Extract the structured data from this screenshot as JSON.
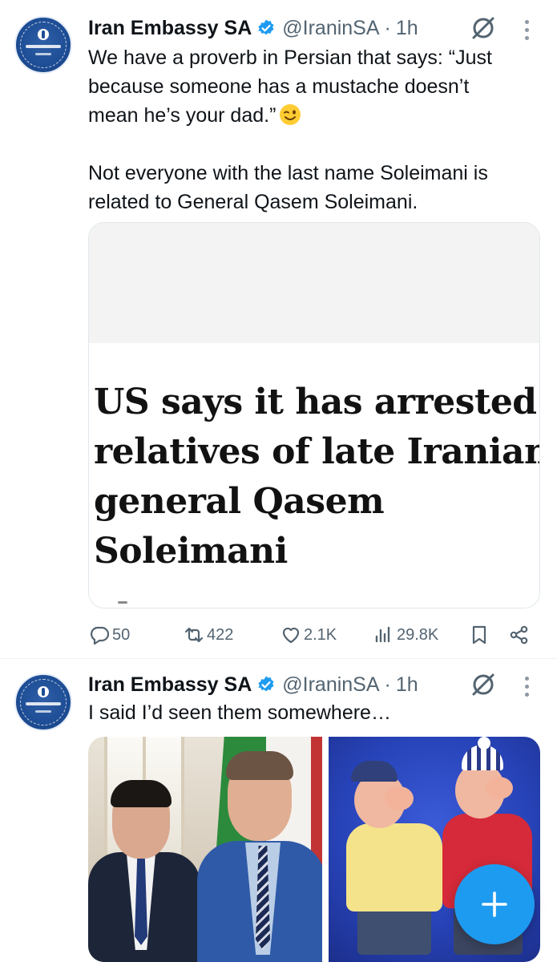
{
  "colors": {
    "accent": "#1d9bf0",
    "text": "#0f1419",
    "secondary": "#536471"
  },
  "tweets": [
    {
      "author": {
        "name": "Iran Embassy SA",
        "handle": "@IraninSA",
        "separator": "·",
        "time": "1h",
        "avatar_icon": "embassy-seal-avatar",
        "verified_icon": "verified-badge-icon"
      },
      "text_lines": [
        "We have a proverb in Persian that says: “Just",
        "because someone has a mustache doesn’t",
        "mean he’s your dad.”",
        "Not everyone with the last name Soleimani is",
        "related to General Qasem Soleimani."
      ],
      "emoji": "winking-face",
      "card": {
        "headline_lines": [
          "US says it has arrested",
          "relatives of late Iranian",
          "general Qasem",
          "Soleimani"
        ]
      },
      "actions": {
        "replies": "50",
        "reposts": "422",
        "likes": "2.1K",
        "views": "29.8K"
      }
    },
    {
      "author": {
        "name": "Iran Embassy SA",
        "handle": "@IraninSA",
        "separator": "·",
        "time": "1h",
        "avatar_icon": "embassy-seal-avatar",
        "verified_icon": "verified-badge-icon"
      },
      "text_lines": [
        "I said I’d seen them somewhere…"
      ],
      "media": [
        "photo-two-officials",
        "photo-two-puppets"
      ]
    }
  ],
  "fab": {
    "icon": "plus-icon",
    "label": "Compose"
  }
}
